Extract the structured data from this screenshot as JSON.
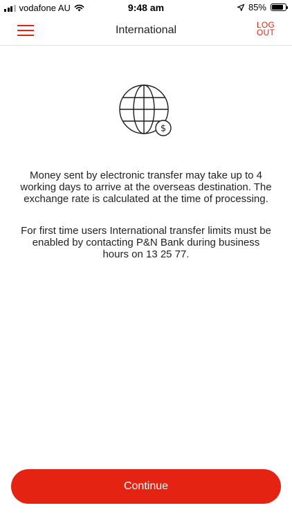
{
  "status_bar": {
    "carrier": "vodafone AU",
    "time": "9:48 am",
    "battery_percent": "85%",
    "battery_level": 0.85,
    "icons": [
      "signal-icon",
      "wifi-icon",
      "location-arrow-icon",
      "battery-icon"
    ]
  },
  "nav": {
    "title": "International",
    "logout_line1": "LOG",
    "logout_line2": "OUT",
    "menu_icon": "hamburger-menu-icon"
  },
  "content": {
    "illustration_icon": "globe-dollar-icon",
    "message1": "Money sent by electronic transfer may take up to 4 working days to arrive at the overseas destination. The exchange rate is calculated at the time of processing.",
    "message2": "For first time users International transfer limits must be enabled by contacting P&N Bank during business hours on 13 25 77."
  },
  "actions": {
    "continue_label": "Continue"
  },
  "colors": {
    "accent": "#e42313",
    "text": "#222222",
    "background": "#ffffff",
    "divider": "#e2e2e2"
  }
}
